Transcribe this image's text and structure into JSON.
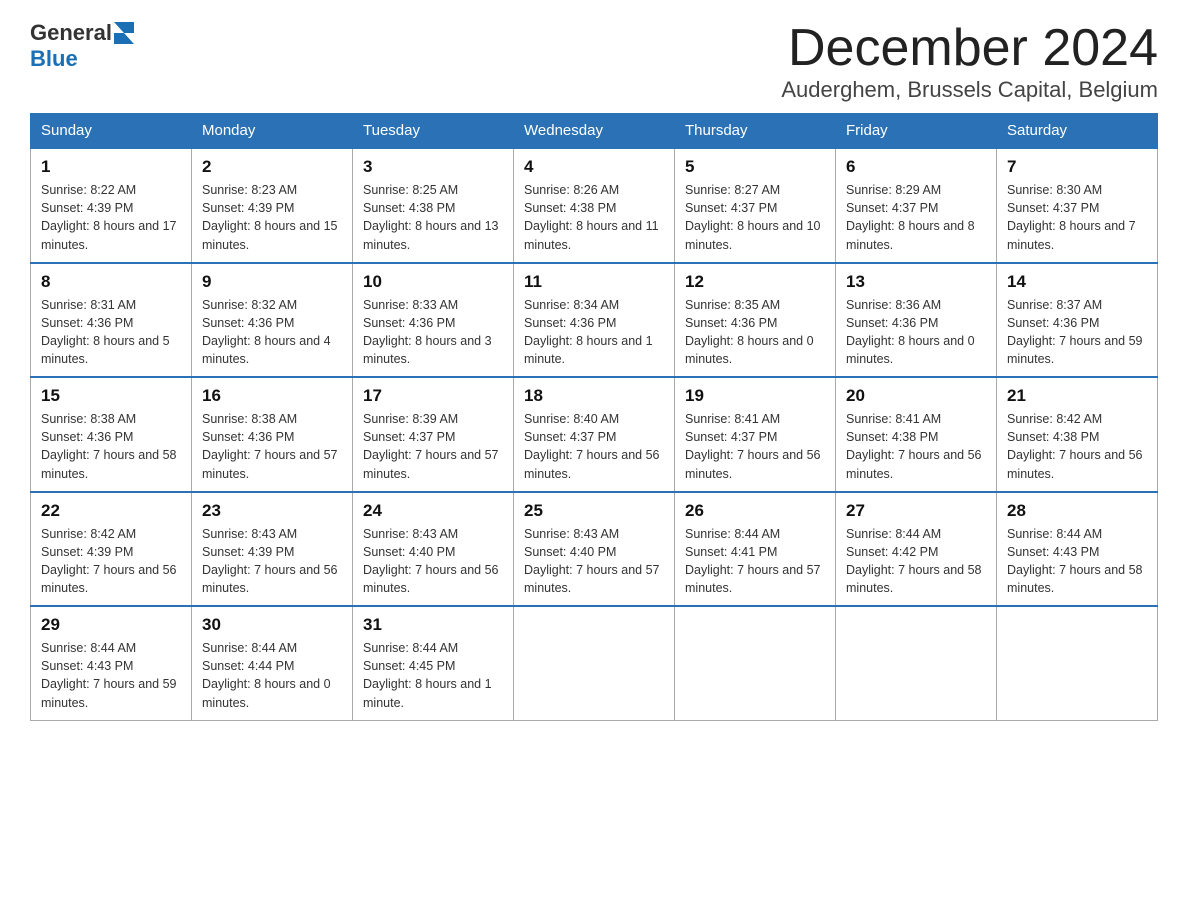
{
  "header": {
    "month_title": "December 2024",
    "location": "Auderghem, Brussels Capital, Belgium",
    "logo_general": "General",
    "logo_blue": "Blue"
  },
  "days_of_week": [
    "Sunday",
    "Monday",
    "Tuesday",
    "Wednesday",
    "Thursday",
    "Friday",
    "Saturday"
  ],
  "weeks": [
    [
      {
        "num": "1",
        "sunrise": "8:22 AM",
        "sunset": "4:39 PM",
        "daylight": "8 hours and 17 minutes."
      },
      {
        "num": "2",
        "sunrise": "8:23 AM",
        "sunset": "4:39 PM",
        "daylight": "8 hours and 15 minutes."
      },
      {
        "num": "3",
        "sunrise": "8:25 AM",
        "sunset": "4:38 PM",
        "daylight": "8 hours and 13 minutes."
      },
      {
        "num": "4",
        "sunrise": "8:26 AM",
        "sunset": "4:38 PM",
        "daylight": "8 hours and 11 minutes."
      },
      {
        "num": "5",
        "sunrise": "8:27 AM",
        "sunset": "4:37 PM",
        "daylight": "8 hours and 10 minutes."
      },
      {
        "num": "6",
        "sunrise": "8:29 AM",
        "sunset": "4:37 PM",
        "daylight": "8 hours and 8 minutes."
      },
      {
        "num": "7",
        "sunrise": "8:30 AM",
        "sunset": "4:37 PM",
        "daylight": "8 hours and 7 minutes."
      }
    ],
    [
      {
        "num": "8",
        "sunrise": "8:31 AM",
        "sunset": "4:36 PM",
        "daylight": "8 hours and 5 minutes."
      },
      {
        "num": "9",
        "sunrise": "8:32 AM",
        "sunset": "4:36 PM",
        "daylight": "8 hours and 4 minutes."
      },
      {
        "num": "10",
        "sunrise": "8:33 AM",
        "sunset": "4:36 PM",
        "daylight": "8 hours and 3 minutes."
      },
      {
        "num": "11",
        "sunrise": "8:34 AM",
        "sunset": "4:36 PM",
        "daylight": "8 hours and 1 minute."
      },
      {
        "num": "12",
        "sunrise": "8:35 AM",
        "sunset": "4:36 PM",
        "daylight": "8 hours and 0 minutes."
      },
      {
        "num": "13",
        "sunrise": "8:36 AM",
        "sunset": "4:36 PM",
        "daylight": "8 hours and 0 minutes."
      },
      {
        "num": "14",
        "sunrise": "8:37 AM",
        "sunset": "4:36 PM",
        "daylight": "7 hours and 59 minutes."
      }
    ],
    [
      {
        "num": "15",
        "sunrise": "8:38 AM",
        "sunset": "4:36 PM",
        "daylight": "7 hours and 58 minutes."
      },
      {
        "num": "16",
        "sunrise": "8:38 AM",
        "sunset": "4:36 PM",
        "daylight": "7 hours and 57 minutes."
      },
      {
        "num": "17",
        "sunrise": "8:39 AM",
        "sunset": "4:37 PM",
        "daylight": "7 hours and 57 minutes."
      },
      {
        "num": "18",
        "sunrise": "8:40 AM",
        "sunset": "4:37 PM",
        "daylight": "7 hours and 56 minutes."
      },
      {
        "num": "19",
        "sunrise": "8:41 AM",
        "sunset": "4:37 PM",
        "daylight": "7 hours and 56 minutes."
      },
      {
        "num": "20",
        "sunrise": "8:41 AM",
        "sunset": "4:38 PM",
        "daylight": "7 hours and 56 minutes."
      },
      {
        "num": "21",
        "sunrise": "8:42 AM",
        "sunset": "4:38 PM",
        "daylight": "7 hours and 56 minutes."
      }
    ],
    [
      {
        "num": "22",
        "sunrise": "8:42 AM",
        "sunset": "4:39 PM",
        "daylight": "7 hours and 56 minutes."
      },
      {
        "num": "23",
        "sunrise": "8:43 AM",
        "sunset": "4:39 PM",
        "daylight": "7 hours and 56 minutes."
      },
      {
        "num": "24",
        "sunrise": "8:43 AM",
        "sunset": "4:40 PM",
        "daylight": "7 hours and 56 minutes."
      },
      {
        "num": "25",
        "sunrise": "8:43 AM",
        "sunset": "4:40 PM",
        "daylight": "7 hours and 57 minutes."
      },
      {
        "num": "26",
        "sunrise": "8:44 AM",
        "sunset": "4:41 PM",
        "daylight": "7 hours and 57 minutes."
      },
      {
        "num": "27",
        "sunrise": "8:44 AM",
        "sunset": "4:42 PM",
        "daylight": "7 hours and 58 minutes."
      },
      {
        "num": "28",
        "sunrise": "8:44 AM",
        "sunset": "4:43 PM",
        "daylight": "7 hours and 58 minutes."
      }
    ],
    [
      {
        "num": "29",
        "sunrise": "8:44 AM",
        "sunset": "4:43 PM",
        "daylight": "7 hours and 59 minutes."
      },
      {
        "num": "30",
        "sunrise": "8:44 AM",
        "sunset": "4:44 PM",
        "daylight": "8 hours and 0 minutes."
      },
      {
        "num": "31",
        "sunrise": "8:44 AM",
        "sunset": "4:45 PM",
        "daylight": "8 hours and 1 minute."
      },
      null,
      null,
      null,
      null
    ]
  ],
  "labels": {
    "sunrise_prefix": "Sunrise: ",
    "sunset_prefix": "Sunset: ",
    "daylight_prefix": "Daylight: "
  }
}
